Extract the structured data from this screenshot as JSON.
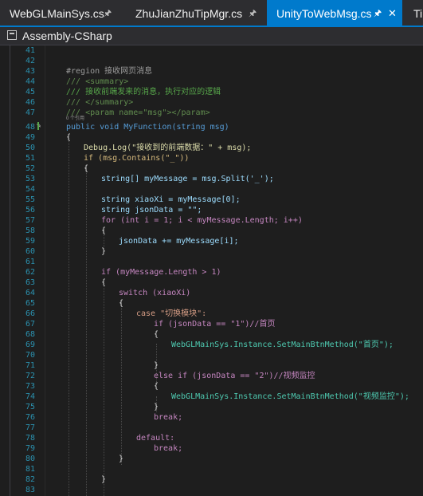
{
  "tabs": [
    {
      "label": "WebGLMainSys.cs",
      "pin": "🖈",
      "active": false
    },
    {
      "label": "ZhuJianZhuTipMgr.cs",
      "pin": "🖈",
      "active": false
    },
    {
      "label": "UnityToWebMsg.cs",
      "pin": "🖈",
      "close": "✕",
      "active": true
    },
    {
      "label": "TipM",
      "active": false
    }
  ],
  "nav": {
    "project": "Assembly-CSharp"
  },
  "codelens": "0 个引用",
  "lines": [
    {
      "n": "41",
      "t": ""
    },
    {
      "n": "42",
      "t": ""
    },
    {
      "n": "43",
      "t": "#region 接收网页消息"
    },
    {
      "n": "44",
      "t": "/// <summary>"
    },
    {
      "n": "45",
      "t": "/// 接收前端发来的消息，执行对应的逻辑"
    },
    {
      "n": "46",
      "t": "/// </summary>"
    },
    {
      "n": "47",
      "t": "/// <param name=\"msg\"></param>"
    },
    {
      "n": "48",
      "t": "public void MyFunction(string msg)"
    },
    {
      "n": "49",
      "t": "{"
    },
    {
      "n": "50",
      "t": "Debug.Log(\"接收到的前端数据：\" + msg);"
    },
    {
      "n": "51",
      "t": "if (msg.Contains(\"_\"))"
    },
    {
      "n": "52",
      "t": "{"
    },
    {
      "n": "53",
      "t": "string[] myMessage = msg.Split('_');"
    },
    {
      "n": "54",
      "t": ""
    },
    {
      "n": "55",
      "t": "string xiaoXi = myMessage[0];"
    },
    {
      "n": "56",
      "t": "string jsonData = \"\";"
    },
    {
      "n": "57",
      "t": "for (int i = 1; i < myMessage.Length; i++)"
    },
    {
      "n": "58",
      "t": "{"
    },
    {
      "n": "59",
      "t": "jsonData += myMessage[i];"
    },
    {
      "n": "60",
      "t": "}"
    },
    {
      "n": "61",
      "t": ""
    },
    {
      "n": "62",
      "t": "if (myMessage.Length > 1)"
    },
    {
      "n": "63",
      "t": "{"
    },
    {
      "n": "64",
      "t": "switch (xiaoXi)"
    },
    {
      "n": "65",
      "t": "{"
    },
    {
      "n": "66",
      "t": "case \"切换模块\":"
    },
    {
      "n": "67",
      "t": "if (jsonData == \"1\")//首页"
    },
    {
      "n": "68",
      "t": "{"
    },
    {
      "n": "69",
      "t": "WebGLMainSys.Instance.SetMainBtnMethod(\"首页\");"
    },
    {
      "n": "70",
      "t": ""
    },
    {
      "n": "71",
      "t": "}"
    },
    {
      "n": "72",
      "t": "else if (jsonData == \"2\")//视频监控"
    },
    {
      "n": "73",
      "t": "{"
    },
    {
      "n": "74",
      "t": "WebGLMainSys.Instance.SetMainBtnMethod(\"视频监控\");"
    },
    {
      "n": "75",
      "t": "}"
    },
    {
      "n": "76",
      "t": "break;"
    },
    {
      "n": "77",
      "t": ""
    },
    {
      "n": "78",
      "t": "default:"
    },
    {
      "n": "79",
      "t": "break;"
    },
    {
      "n": "80",
      "t": "}"
    },
    {
      "n": "81",
      "t": ""
    },
    {
      "n": "82",
      "t": "}"
    },
    {
      "n": "83",
      "t": ""
    }
  ]
}
